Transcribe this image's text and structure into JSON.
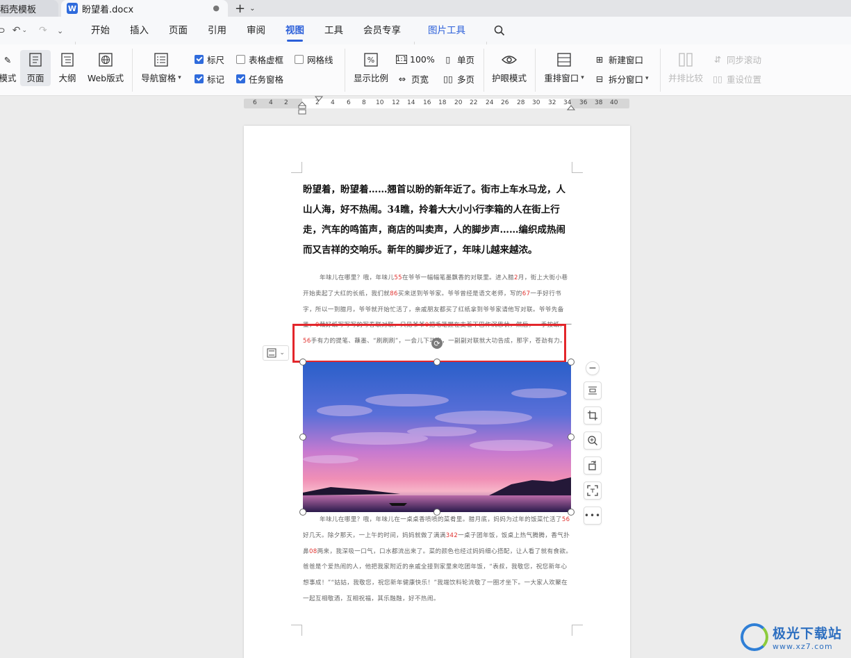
{
  "tabs": [
    {
      "label": "稻壳模板"
    },
    {
      "label": "盼望着.docx",
      "icon": "W"
    }
  ],
  "tab_modified_dot": "●",
  "new_tab": "+",
  "menu": {
    "items": [
      "开始",
      "插入",
      "页面",
      "引用",
      "审阅",
      "视图",
      "工具",
      "会员专享"
    ],
    "active": "视图",
    "picture_tools": "图片工具"
  },
  "ribbon": {
    "mode_partial": "模式",
    "page": "页面",
    "outline": "大纲",
    "web": "Web版式",
    "nav_pane": "导航窗格",
    "ruler": "标尺",
    "marks": "标记",
    "table_grid": "表格虚框",
    "task_pane": "任务窗格",
    "gridlines": "网格线",
    "zoom": "显示比例",
    "zoom_100": "100%",
    "page_width": "页宽",
    "single_page": "单页",
    "multi_page": "多页",
    "eye_mode": "护眼模式",
    "arrange": "重排窗口",
    "new_window": "新建窗口",
    "split_window": "拆分窗口",
    "side_by_side": "并排比较",
    "sync_scroll": "同步滚动",
    "reset_pos": "重设位置"
  },
  "ruler_numbers": [
    "6",
    "4",
    "2",
    "2",
    "4",
    "6",
    "8",
    "10",
    "12",
    "14",
    "16",
    "18",
    "20",
    "22",
    "24",
    "26",
    "28",
    "30",
    "32",
    "34",
    "36",
    "38",
    "40"
  ],
  "document": {
    "heading": "盼望着，盼望着……翘首以盼的新年近了。街市上车水马龙，人山人海，好不热闹。34瞧，拎着大大小小行李箱的人在街上行走，汽车的鸣笛声，商店的叫卖声，人的脚步声……编织成热闹而又吉祥的交响乐。新年的脚步近了，年味儿越来越浓。",
    "p1": {
      "a": "年味儿在哪里？哦，年味儿",
      "n1": "55",
      "b": "在爷爷一幅幅笔墨飘香的对联里。进入腊",
      "n2": "2",
      "c": "月，街上大街小巷开始卖起了大红的长纸，我们就",
      "n3": "86",
      "d": "买来送到爷爷家。爷爷曾经是语文老师，写的",
      "n4": "67",
      "e": "一手好行书字，所以一到腊月，爷爷就开始忙活了，亲戚朋友都买了红纸拿到爷爷家请他写对联。爷爷先备墨，",
      "n5": "0",
      "f": "裁好纸写写写的写春联对联，只见爷爷",
      "n6": "0",
      "g": "把毛笔握在支着下巴作沉思状，然后，一手按纸，一",
      "n7": "56",
      "h": "手有力的提笔、蘸墨、“刷刷刷”，一会儿下功夫，一副副对联就大功告成，那字，苍劲有力。"
    },
    "p2": {
      "a": "年味儿在哪里？哦，年味儿在一桌桌香喷喷的菜肴里。腊月底，妈妈为过年的饭菜忙活了",
      "n1": "56",
      "b": "好几天。除夕那天，一上午的时间，妈妈就做了满满",
      "n2": "342",
      "c": "一桌子团年饭，饭桌上热气腾腾，香气扑鼻",
      "n3": "08",
      "d": "两来，我深吸一口气，口水都流出来了。菜的颜色也经过妈妈细心搭配，让人看了就有食欲。爸爸是个爱热闹的人，他把我家附近的亲戚全接到家里来吃团年饭，“表叔，我敬您，祝您新年心想事成！”“姑姑，我敬您，祝您新年健康快乐！”我端饮料轮流敬了一圈才坐下。一大家人欢聚在一起互相敬酒，互相祝福，其乐融融，好不热闹。"
    }
  },
  "watermark": {
    "name": "极光下载站",
    "url": "www.xz7.com"
  }
}
